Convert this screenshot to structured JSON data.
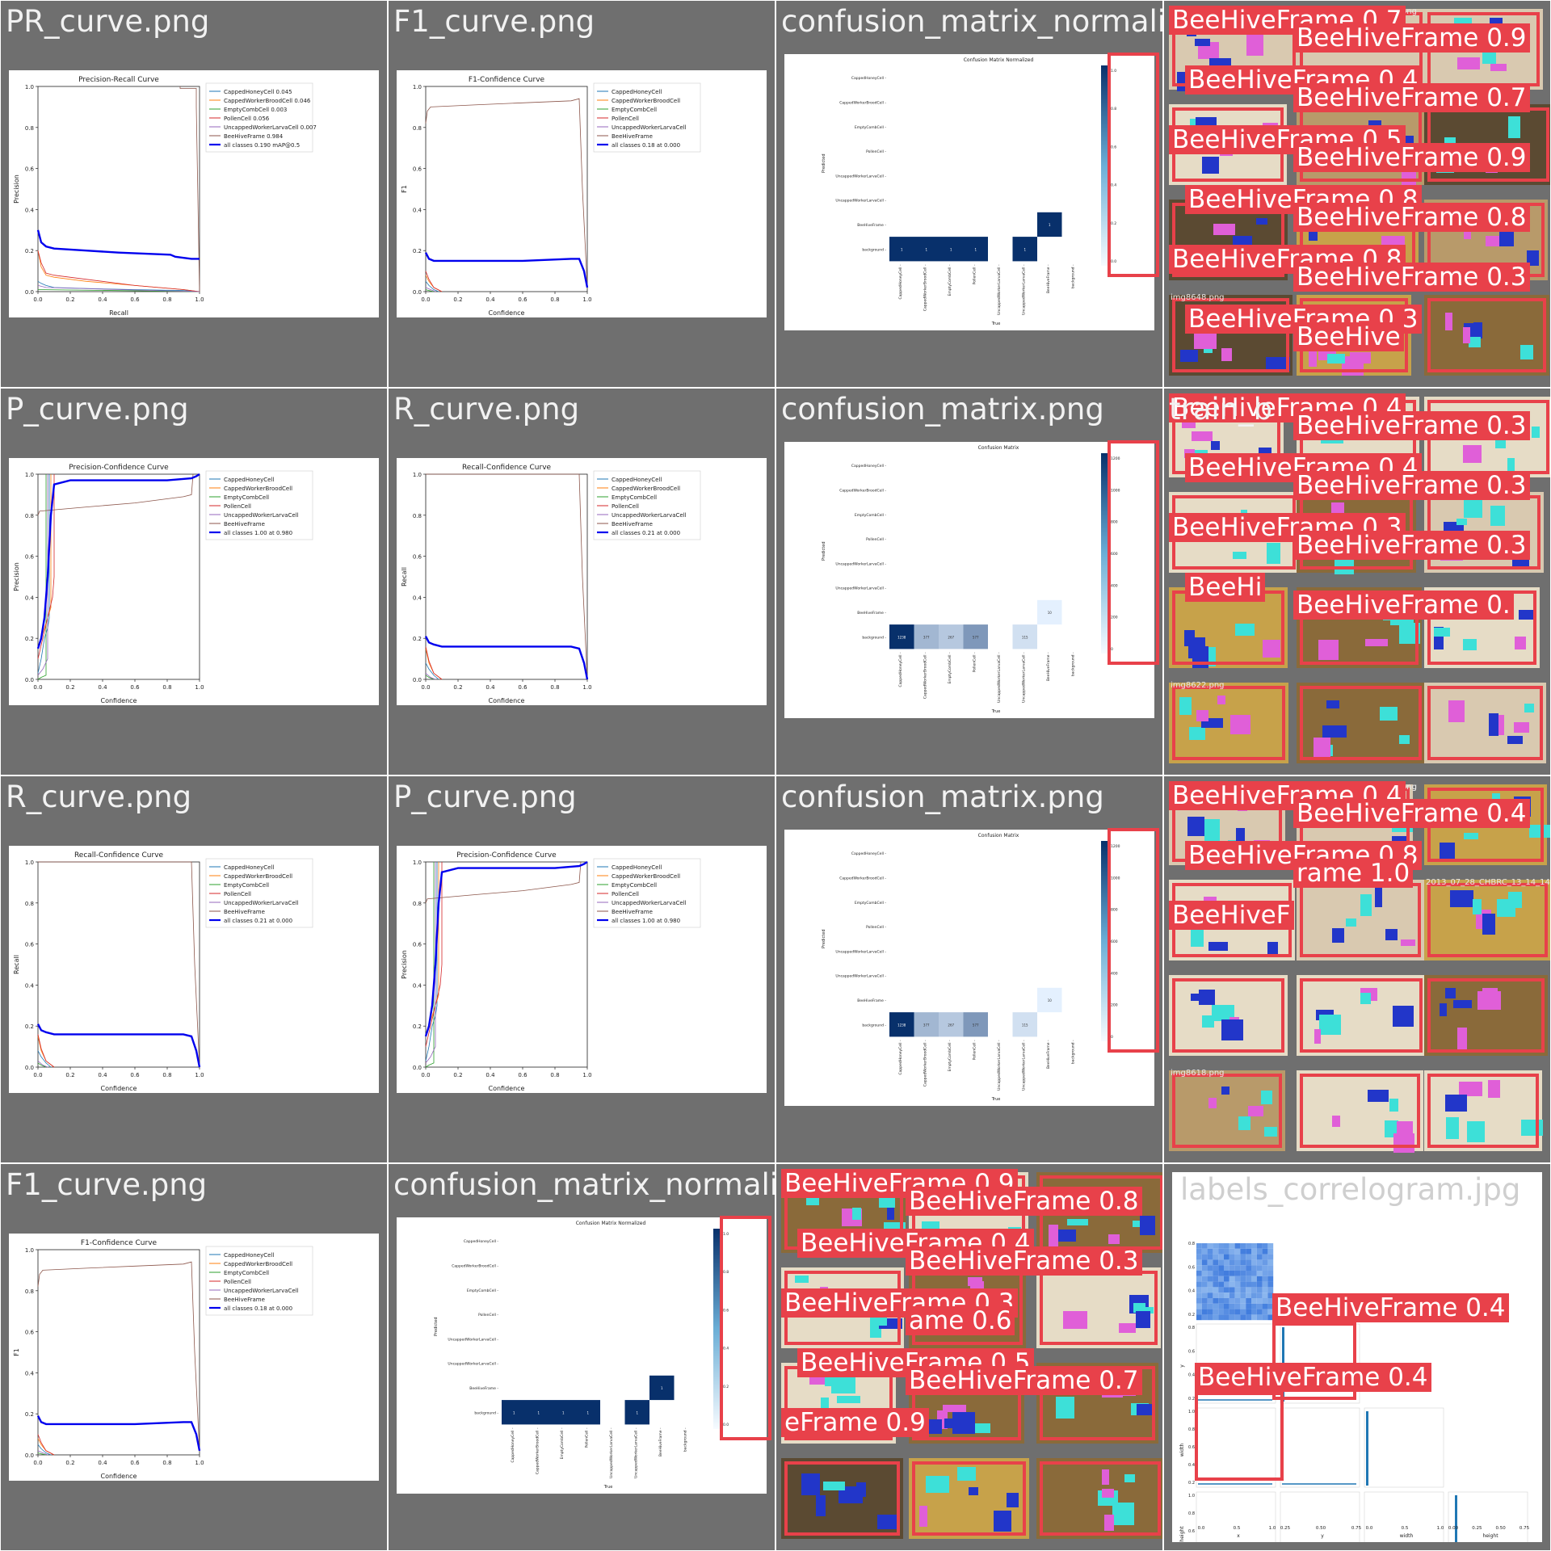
{
  "page": {
    "background": "#ffffff",
    "tile_bg": "#6f6f6f",
    "title_color": "#f2f2f2",
    "det_color": "#e8414a"
  },
  "tiles": [
    {
      "key": "t00",
      "title": "PR_curve.png",
      "kind": "pr"
    },
    {
      "key": "t01",
      "title": "F1_curve.png",
      "kind": "f1"
    },
    {
      "key": "t02",
      "title": "confusion_matrix_normalized",
      "kind": "cmn"
    },
    {
      "key": "t03",
      "title": "",
      "kind": "mosaic"
    },
    {
      "key": "t10",
      "title": "P_curve.png",
      "kind": "p"
    },
    {
      "key": "t11",
      "title": "R_curve.png",
      "kind": "r"
    },
    {
      "key": "t12",
      "title": "confusion_matrix.png",
      "kind": "cm"
    },
    {
      "key": "t13",
      "title": "train_b",
      "kind": "mosaic"
    },
    {
      "key": "t20",
      "title": "R_curve.png",
      "kind": "r"
    },
    {
      "key": "t21",
      "title": "P_curve.png",
      "kind": "p"
    },
    {
      "key": "t22",
      "title": "confusion_matrix.png",
      "kind": "cm"
    },
    {
      "key": "t23",
      "title": "",
      "kind": "mosaic"
    },
    {
      "key": "t30",
      "title": "F1_curve.png",
      "kind": "f1"
    },
    {
      "key": "t31",
      "title": "confusion_matrix_normalized",
      "kind": "cmn"
    },
    {
      "key": "t32",
      "title": "",
      "kind": "mosaic"
    },
    {
      "key": "t33",
      "title": "labels_correlogram.jpg",
      "kind": "corr"
    }
  ],
  "legend_classes": [
    "CappedHoneyCell",
    "CappedWorkerBroodCell",
    "EmptyCombCell",
    "PollenCell",
    "UncappedWorkerLarvaCell",
    "BeeHiveFrame"
  ],
  "class_colors": [
    "#1f77b4",
    "#ff7f0e",
    "#2ca02c",
    "#d62728",
    "#9467bd",
    "#8c564b"
  ],
  "chart_data": [
    {
      "type": "line",
      "title": "Precision-Recall Curve",
      "xlabel": "Recall",
      "ylabel": "Precision",
      "xlim": [
        0,
        1
      ],
      "ylim": [
        0,
        1
      ],
      "legend": "top-right",
      "series": [
        {
          "name": "CappedHoneyCell 0.045",
          "x": [
            0,
            0.02,
            0.05,
            0.1,
            0.3,
            0.6,
            0.9,
            1.0
          ],
          "y": [
            0.05,
            0.04,
            0.03,
            0.02,
            0.015,
            0.01,
            0.005,
            0
          ]
        },
        {
          "name": "CappedWorkerBroodCell 0.046",
          "x": [
            0,
            0.02,
            0.05,
            0.1,
            0.3,
            0.6,
            0.9,
            1.0
          ],
          "y": [
            0.2,
            0.12,
            0.08,
            0.07,
            0.05,
            0.03,
            0.01,
            0
          ]
        },
        {
          "name": "EmptyCombCell 0.003",
          "x": [
            0,
            0.5,
            1.0
          ],
          "y": [
            0.01,
            0.005,
            0
          ]
        },
        {
          "name": "PollenCell 0.056",
          "x": [
            0,
            0.02,
            0.05,
            0.1,
            0.3,
            0.6,
            0.9,
            1.0
          ],
          "y": [
            0.2,
            0.14,
            0.09,
            0.08,
            0.06,
            0.03,
            0.01,
            0
          ]
        },
        {
          "name": "UncappedWorkerLarvaCell 0.007",
          "x": [
            0,
            0.05,
            0.5,
            1.0
          ],
          "y": [
            0.03,
            0.02,
            0.01,
            0
          ]
        },
        {
          "name": "BeeHiveFrame 0.984",
          "x": [
            0.88,
            0.88,
            0.98,
            0.98,
            1.0
          ],
          "y": [
            1,
            0.99,
            0.99,
            0.9,
            0
          ]
        },
        {
          "name": "all classes 0.190 mAP@0.5",
          "x": [
            0,
            0.02,
            0.05,
            0.1,
            0.3,
            0.5,
            0.82,
            0.85,
            0.95,
            1.0
          ],
          "y": [
            0.3,
            0.24,
            0.22,
            0.21,
            0.2,
            0.19,
            0.18,
            0.17,
            0.16,
            0.16
          ]
        }
      ]
    },
    {
      "type": "line",
      "title": "F1-Confidence Curve",
      "xlabel": "Confidence",
      "ylabel": "F1",
      "xlim": [
        0,
        1
      ],
      "ylim": [
        0,
        1
      ],
      "legend": "top-right",
      "series": [
        {
          "name": "CappedHoneyCell",
          "x": [
            0,
            0.02,
            0.05,
            0.08
          ],
          "y": [
            0.05,
            0.03,
            0.01,
            0
          ]
        },
        {
          "name": "CappedWorkerBroodCell",
          "x": [
            0,
            0.02,
            0.05,
            0.1
          ],
          "y": [
            0.08,
            0.05,
            0.02,
            0
          ]
        },
        {
          "name": "EmptyCombCell",
          "x": [
            0,
            0.02,
            0.05
          ],
          "y": [
            0.01,
            0.005,
            0
          ]
        },
        {
          "name": "PollenCell",
          "x": [
            0,
            0.02,
            0.05,
            0.1
          ],
          "y": [
            0.1,
            0.06,
            0.02,
            0
          ]
        },
        {
          "name": "UncappedWorkerLarvaCell",
          "x": [
            0,
            0.03,
            0.06
          ],
          "y": [
            0.02,
            0.01,
            0
          ]
        },
        {
          "name": "BeeHiveFrame",
          "x": [
            0,
            0.01,
            0.03,
            0.3,
            0.6,
            0.9,
            0.95,
            0.97,
            1.0
          ],
          "y": [
            0.82,
            0.88,
            0.9,
            0.91,
            0.92,
            0.93,
            0.94,
            0.5,
            0.02
          ]
        },
        {
          "name": "all classes 0.18 at 0.000",
          "x": [
            0,
            0.02,
            0.05,
            0.1,
            0.3,
            0.6,
            0.9,
            0.95,
            0.98,
            1.0
          ],
          "y": [
            0.19,
            0.16,
            0.15,
            0.15,
            0.15,
            0.15,
            0.16,
            0.16,
            0.1,
            0.02
          ]
        }
      ]
    },
    {
      "type": "heatmap",
      "title": "Confusion Matrix Normalized",
      "xlabel": "True",
      "ylabel": "Predicted",
      "y_categories": [
        "CappedHoneyCell",
        "CappedWorkerBroodCell",
        "EmptyCombCell",
        "PollenCell",
        "UncappedWorkerLarvaCell",
        "UncappedWorkerLarvaCell",
        "BeeHiveFrame",
        "background"
      ],
      "x_categories": [
        "CappedHoneyCell",
        "CappedWorkerBroodCell",
        "EmptyCombCell",
        "PollenCell",
        "UncappedWorkerLarvaCell",
        "UncappedWorkerLarvaCell",
        "BeeHiveFrame",
        "background"
      ],
      "cells": [
        {
          "row": 6,
          "col": 6,
          "value": 1.0
        },
        {
          "row": 7,
          "col": 0,
          "value": 1.0
        },
        {
          "row": 7,
          "col": 1,
          "value": 1.0
        },
        {
          "row": 7,
          "col": 2,
          "value": 1.0
        },
        {
          "row": 7,
          "col": 3,
          "value": 1.0
        },
        {
          "row": 7,
          "col": 5,
          "value": 1.0
        }
      ],
      "colorbar_ticks": [
        "1.0",
        "0.8",
        "0.6",
        "0.4",
        "0.2",
        "0.0"
      ]
    },
    {
      "type": "line",
      "title": "Precision-Confidence Curve",
      "xlabel": "Confidence",
      "ylabel": "Precision",
      "xlim": [
        0,
        1
      ],
      "ylim": [
        0,
        1
      ],
      "legend": "top-right",
      "series": [
        {
          "name": "CappedHoneyCell",
          "x": [
            0,
            0.02,
            0.04,
            0.06,
            0.07,
            0.07
          ],
          "y": [
            0.03,
            0.1,
            0.2,
            0.25,
            0.3,
            1
          ]
        },
        {
          "name": "CappedWorkerBroodCell",
          "x": [
            0,
            0.02,
            0.04,
            0.06,
            0.08,
            0.08
          ],
          "y": [
            0.15,
            0.2,
            0.25,
            0.3,
            0.35,
            1
          ]
        },
        {
          "name": "EmptyCombCell",
          "x": [
            0,
            0.02,
            0.05,
            0.05
          ],
          "y": [
            0,
            0.01,
            0.02,
            1
          ]
        },
        {
          "name": "PollenCell",
          "x": [
            0,
            0.03,
            0.06,
            0.09,
            0.1,
            0.1
          ],
          "y": [
            0.1,
            0.2,
            0.3,
            0.4,
            0.5,
            1
          ]
        },
        {
          "name": "UncappedWorkerLarvaCell",
          "x": [
            0,
            0.03,
            0.06,
            0.06
          ],
          "y": [
            0.02,
            0.05,
            0.1,
            1
          ]
        },
        {
          "name": "BeeHiveFrame",
          "x": [
            0,
            0.01,
            0.3,
            0.6,
            0.9,
            0.95,
            0.96
          ],
          "y": [
            0.8,
            0.82,
            0.84,
            0.86,
            0.89,
            0.9,
            1
          ]
        },
        {
          "name": "all classes 1.00 at 0.980",
          "x": [
            0,
            0.02,
            0.04,
            0.06,
            0.08,
            0.1,
            0.2,
            0.5,
            0.8,
            0.95,
            0.98,
            1.0
          ],
          "y": [
            0.15,
            0.2,
            0.3,
            0.5,
            0.8,
            0.95,
            0.97,
            0.97,
            0.97,
            0.98,
            0.99,
            1.0
          ]
        }
      ]
    },
    {
      "type": "line",
      "title": "Recall-Confidence Curve",
      "xlabel": "Confidence",
      "ylabel": "Recall",
      "xlim": [
        0,
        1
      ],
      "ylim": [
        0,
        1
      ],
      "legend": "top-right",
      "series": [
        {
          "name": "CappedHoneyCell",
          "x": [
            0,
            0.02,
            0.05,
            0.08
          ],
          "y": [
            0.08,
            0.05,
            0.02,
            0
          ]
        },
        {
          "name": "CappedWorkerBroodCell",
          "x": [
            0,
            0.02,
            0.05,
            0.1
          ],
          "y": [
            0.15,
            0.08,
            0.03,
            0
          ]
        },
        {
          "name": "EmptyCombCell",
          "x": [
            0,
            0.02,
            0.05
          ],
          "y": [
            0.02,
            0.01,
            0
          ]
        },
        {
          "name": "PollenCell",
          "x": [
            0,
            0.02,
            0.05,
            0.1
          ],
          "y": [
            0.16,
            0.09,
            0.03,
            0
          ]
        },
        {
          "name": "UncappedWorkerLarvaCell",
          "x": [
            0,
            0.03,
            0.06
          ],
          "y": [
            0.03,
            0.01,
            0
          ]
        },
        {
          "name": "BeeHiveFrame",
          "x": [
            0,
            0.3,
            0.6,
            0.9,
            0.95,
            0.97,
            1.0
          ],
          "y": [
            1,
            1,
            1,
            1,
            1,
            0.5,
            0
          ]
        },
        {
          "name": "all classes 0.21 at 0.000",
          "x": [
            0,
            0.02,
            0.05,
            0.1,
            0.3,
            0.6,
            0.9,
            0.95,
            0.98,
            1.0
          ],
          "y": [
            0.21,
            0.18,
            0.17,
            0.16,
            0.16,
            0.16,
            0.16,
            0.15,
            0.08,
            0.0
          ]
        }
      ]
    },
    {
      "type": "heatmap",
      "title": "Confusion Matrix",
      "xlabel": "True",
      "ylabel": "Predicted",
      "y_categories": [
        "CappedHoneyCell",
        "CappedWorkerBroodCell",
        "EmptyCombCell",
        "PollenCell",
        "UncappedWorkerLarvaCell",
        "UncappedWorkerLarvaCell",
        "BeeHiveFrame",
        "background"
      ],
      "x_categories": [
        "CappedHoneyCell",
        "CappedWorkerBroodCell",
        "EmptyCombCell",
        "PollenCell",
        "UncappedWorkerLarvaCell",
        "UncappedWorkerLarvaCell",
        "BeeHiveFrame",
        "background"
      ],
      "cells": [
        {
          "row": 6,
          "col": 6,
          "value": 10
        },
        {
          "row": 7,
          "col": 0,
          "value": 1238
        },
        {
          "row": 7,
          "col": 1,
          "value": 377
        },
        {
          "row": 7,
          "col": 2,
          "value": 267
        },
        {
          "row": 7,
          "col": 3,
          "value": 577
        },
        {
          "row": 7,
          "col": 5,
          "value": 115
        }
      ],
      "colorbar_ticks": [
        "1200",
        "1000",
        "800",
        "600",
        "400",
        "200",
        "0"
      ]
    },
    {
      "type": "scatter",
      "title": "labels_correlogram.jpg",
      "variables": [
        "x",
        "y",
        "width",
        "height"
      ],
      "x_ticks": {
        "x": [
          "0.0",
          "0.5",
          "1.0"
        ],
        "y": [
          "0.25",
          "0.50",
          "0.75"
        ],
        "width": [
          "0.0",
          "0.5",
          "1.0"
        ],
        "height": [
          "0.00",
          "0.25",
          "0.50",
          "0.75"
        ]
      },
      "y_ticks": {
        "y": [
          "0.2",
          "0.4",
          "0.6",
          "0.8"
        ],
        "width": [
          "0.2",
          "0.4",
          "0.6",
          "0.8",
          "1.0"
        ],
        "height": [
          "0.2",
          "0.4",
          "0.6",
          "0.8",
          "1.0"
        ]
      }
    }
  ],
  "mosaics": {
    "t03": {
      "captions": [
        "2013_07_21_CHBRC_015.png",
        "img8607.png",
        "img8648.png"
      ],
      "labels": [
        {
          "text": "BeeHiveFrame 0.7"
        },
        {
          "text": "BeeHiveFrame 0.9"
        },
        {
          "text": "BeeHiveFrame 0.4"
        },
        {
          "text": "BeeHiveFrame 0.7"
        },
        {
          "text": "BeeHiveFrame 0.5"
        },
        {
          "text": "BeeHiveFrame 0.9"
        },
        {
          "text": "BeeHiveFrame 0.8"
        },
        {
          "text": "BeeHiveFrame 0.8"
        },
        {
          "text": "BeeHiveFrame 0.8"
        },
        {
          "text": "BeeHiveFrame 0.3"
        },
        {
          "text": "BeeHiveFrame 0.3"
        },
        {
          "text": "BeeHive"
        }
      ]
    },
    "t13": {
      "captions": [
        "img8627.png",
        "2013_07",
        "img8622.png"
      ],
      "labels": [
        {
          "text": "BeeHiveFrame 0.4"
        },
        {
          "text": "BeeHiveFrame 0.3"
        },
        {
          "text": "BeeHiveFrame 0.4"
        },
        {
          "text": "BeeHiveFrame 0.3"
        },
        {
          "text": "BeeHiveFrame 0.3"
        },
        {
          "text": "BeeHiveFrame 0.3"
        },
        {
          "text": "BeeHi"
        },
        {
          "text": "BeeHiveFrame 0."
        }
      ]
    },
    "t23": {
      "captions": [
        "2013_07_28_CHBRC_012.png",
        "2013_07_28_CHBRC_13_14_147_R.png",
        "img8618.png",
        "2013_07_28_CHBRC_013.png"
      ],
      "labels": [
        {
          "text": "BeeHiveFrame 0.4"
        },
        {
          "text": "BeeHiveFrame 0.4"
        },
        {
          "text": "BeeHiveFrame 0.8"
        },
        {
          "text": "rame 1.0"
        },
        {
          "text": "BeeHiveF"
        }
      ]
    },
    "t32": {
      "captions": [
        "2013_07_28_CHBRC"
      ],
      "labels": [
        {
          "text": "BeeHiveFrame 0.9"
        },
        {
          "text": "BeeHiveFrame 0.8"
        },
        {
          "text": "BeeHiveFrame 0.4"
        },
        {
          "text": "BeeHiveFrame 0.3"
        },
        {
          "text": "BeeHiveFrame 0.3"
        },
        {
          "text": "ame 0.6"
        },
        {
          "text": "BeeHiveFrame 0.5"
        },
        {
          "text": "BeeHiveFrame 0.7"
        },
        {
          "text": "eFrame 0.9"
        }
      ]
    },
    "t33": {
      "labels": [
        {
          "text": "BeeHiveFrame 0.4"
        },
        {
          "text": "BeeHiveFrame 0.4"
        }
      ]
    }
  }
}
